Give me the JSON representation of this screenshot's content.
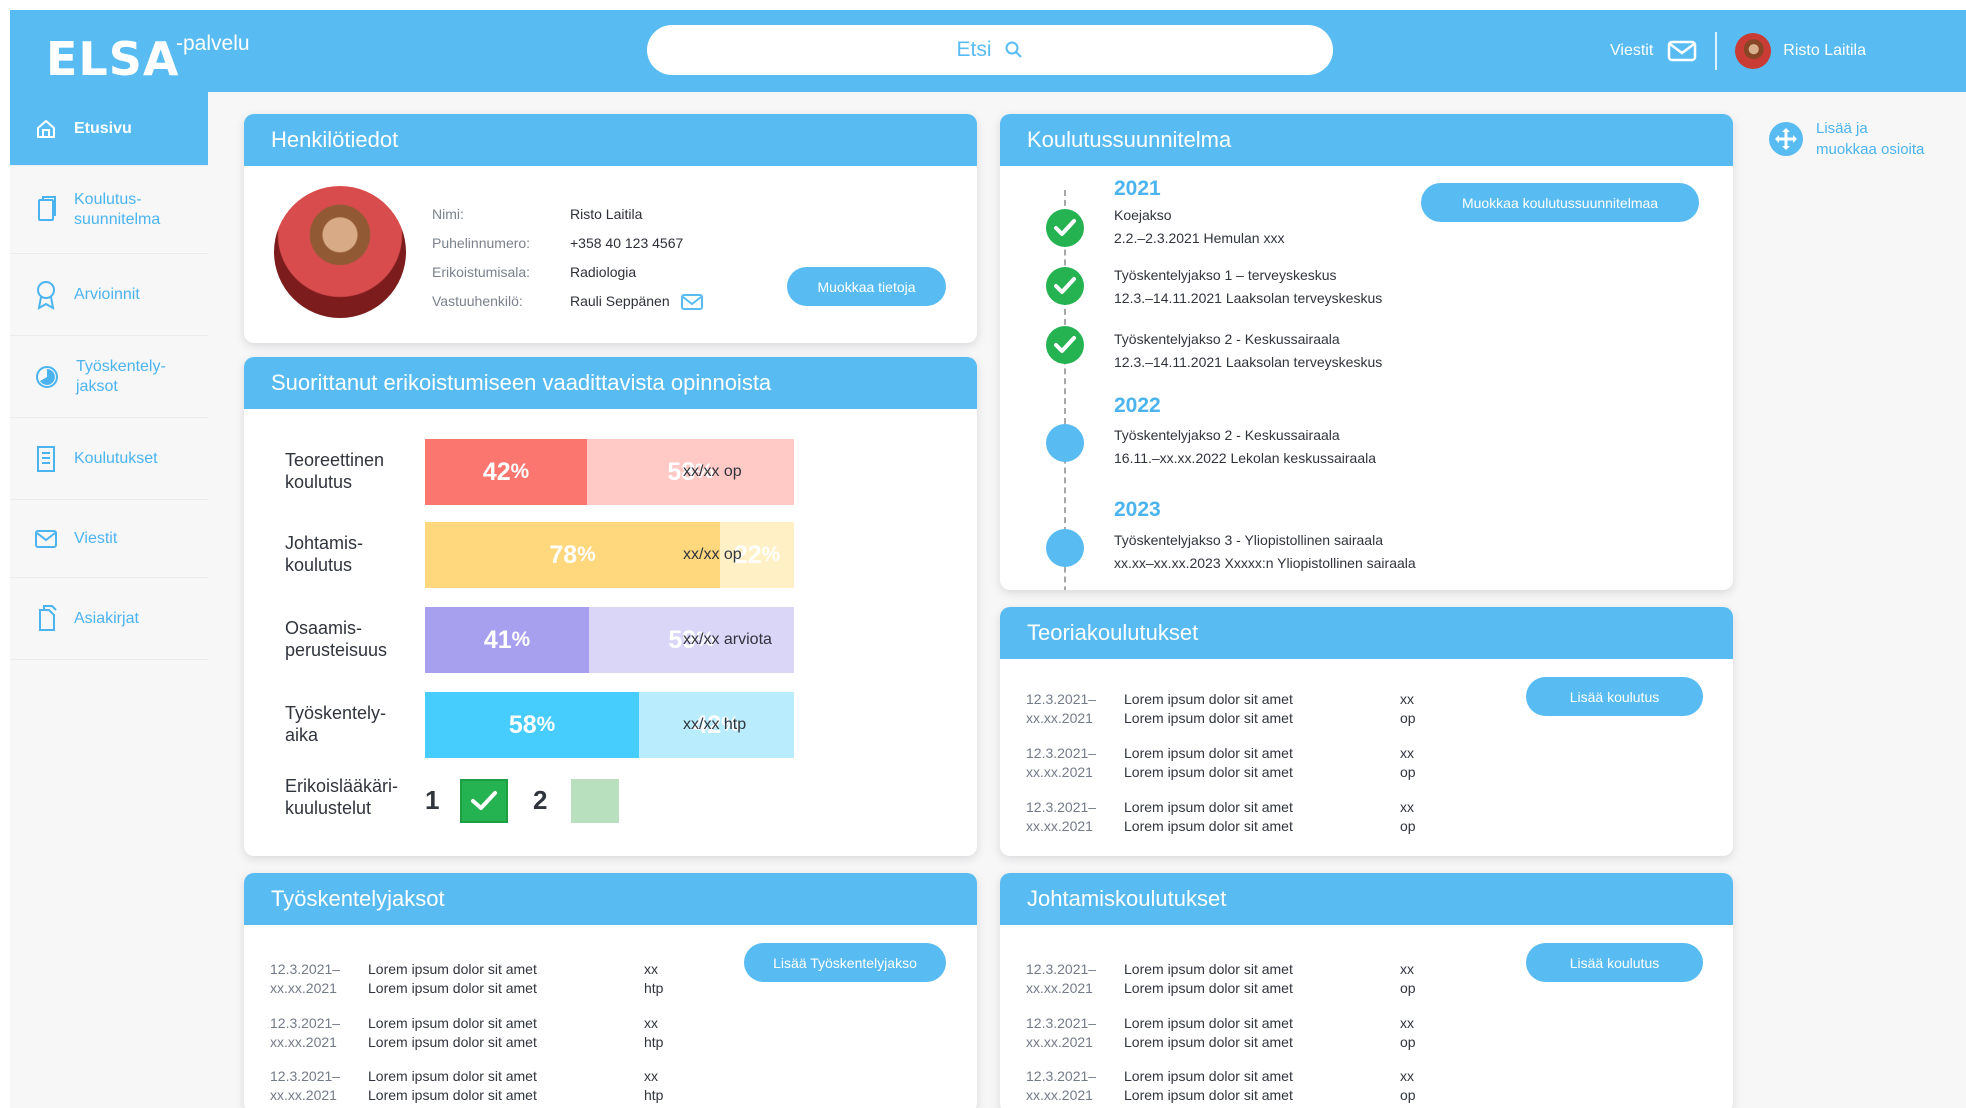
{
  "app": {
    "brand": "ELSA",
    "brand_suffix": "-palvelu",
    "search_placeholder": "Etsi",
    "messages_label": "Viestit",
    "user_name": "Risto Laitila"
  },
  "sidebar": {
    "items": [
      {
        "label": "Etusivu",
        "icon": "home-icon"
      },
      {
        "label": "Koulutus-\nsuunnitelma",
        "icon": "document-copy-icon"
      },
      {
        "label": "Arvioinnit",
        "icon": "award-icon"
      },
      {
        "label": "Työskentely-\njaksot",
        "icon": "clock-icon"
      },
      {
        "label": "Koulutukset",
        "icon": "notebook-icon"
      },
      {
        "label": "Viestit",
        "icon": "mail-icon"
      },
      {
        "label": "Asiakirjat",
        "icon": "documents-icon"
      }
    ]
  },
  "tools": {
    "edit_sections": "Lisää ja\nmuokkaa osioita"
  },
  "personal": {
    "title": "Henkilötiedot",
    "labels": [
      "Nimi:",
      "Puhelinnumero:",
      "Erikoistumisala:",
      "Vastuuhenkilö:"
    ],
    "values": [
      "Risto Laitila",
      "+358 40 123 4567",
      "Radiologia",
      "Rauli Seppänen"
    ],
    "edit_button": "Muokkaa tietoja"
  },
  "studies": {
    "title": "Suorittanut erikoistumiseen vaadittavista opinnoista",
    "rows": [
      {
        "label": "Teoreettinen\nkoulutus",
        "completed": 42,
        "remaining": 58,
        "unit": "xx/xx op"
      },
      {
        "label": "Johtamis-\nkoulutus",
        "completed": 78,
        "remaining": 22,
        "unit": "xx/xx op"
      },
      {
        "label": "Osaamis-\nperusteisuus",
        "completed": 41,
        "remaining": 59,
        "unit": "xx/xx arviota"
      },
      {
        "label": "Työskentely-\naika",
        "completed": 58,
        "remaining": 42,
        "unit": "xx/xx htp"
      }
    ],
    "exam_label": "Erikoislääkäri-\nkuulustelut",
    "exam_items": [
      {
        "number": "1",
        "status": "checked"
      },
      {
        "number": "2",
        "status": "pending"
      }
    ],
    "colors": {
      "theory_done": "#fb766e",
      "theory_left": "#ffc9c6",
      "leadership_done": "#ffd77d",
      "leadership_left": "#fff0c6",
      "competence_done": "#a7a0ef",
      "competence_left": "#dad6f8",
      "work_done": "#46ccfd",
      "work_left": "#b9ecfd"
    }
  },
  "plan": {
    "title": "Koulutussuunnitelma",
    "edit_button": "Muokkaa koulutussuunnitelmaa",
    "years": [
      {
        "year": "2021",
        "items": [
          {
            "title": "Koejakso",
            "detail": "2.2.–2.3.2021 Hemulan xxx",
            "status": "done"
          },
          {
            "title": "Työskentelyjakso 1 – terveyskeskus",
            "detail": "12.3.–14.11.2021 Laaksolan terveyskeskus",
            "status": "done"
          },
          {
            "title": "Työskentelyjakso 2 - Keskussairaala",
            "detail": "12.3.–14.11.2021 Laaksolan terveyskeskus",
            "status": "done"
          }
        ]
      },
      {
        "year": "2022",
        "items": [
          {
            "title": "Työskentelyjakso 2 - Keskussairaala",
            "detail": "16.11.–xx.xx.2022 Lekolan keskussairaala",
            "status": "upcoming"
          }
        ]
      },
      {
        "year": "2023",
        "items": [
          {
            "title": "Työskentelyjakso 3 - Yliopistollinen sairaala",
            "detail": "xx.xx–xx.xx.2023 Xxxxx:n Yliopistollinen sairaala",
            "status": "upcoming"
          }
        ]
      }
    ]
  },
  "theory": {
    "title": "Teoriakoulutukset",
    "button": "Lisää koulutus",
    "rows": [
      {
        "date": "12.3.2021–\nxx.xx.2021",
        "text": "Lorem ipsum dolor sit amet\nLorem ipsum dolor sit amet",
        "amount": "xx op"
      },
      {
        "date": "12.3.2021–\nxx.xx.2021",
        "text": "Lorem ipsum dolor sit amet\nLorem ipsum dolor sit amet",
        "amount": "xx op"
      },
      {
        "date": "12.3.2021–\nxx.xx.2021",
        "text": "Lorem ipsum dolor sit amet\nLorem ipsum dolor sit amet",
        "amount": "xx op"
      }
    ]
  },
  "work_periods": {
    "title": "Työskentelyjaksot",
    "button": "Lisää Työskentelyjakso",
    "rows": [
      {
        "date": "12.3.2021–\nxx.xx.2021",
        "text": "Lorem ipsum dolor sit amet\nLorem ipsum dolor sit amet",
        "amount": "xx htp"
      },
      {
        "date": "12.3.2021–\nxx.xx.2021",
        "text": "Lorem ipsum dolor sit amet\nLorem ipsum dolor sit amet",
        "amount": "xx htp"
      },
      {
        "date": "12.3.2021–\nxx.xx.2021",
        "text": "Lorem ipsum dolor sit amet\nLorem ipsum dolor sit amet",
        "amount": "xx htp"
      }
    ]
  },
  "leadership": {
    "title": "Johtamiskoulutukset",
    "button": "Lisää koulutus",
    "rows": [
      {
        "date": "12.3.2021–\nxx.xx.2021",
        "text": "Lorem ipsum dolor sit amet\nLorem ipsum dolor sit amet",
        "amount": "xx op"
      },
      {
        "date": "12.3.2021–\nxx.xx.2021",
        "text": "Lorem ipsum dolor sit amet\nLorem ipsum dolor sit amet",
        "amount": "xx op"
      },
      {
        "date": "12.3.2021–\nxx.xx.2021",
        "text": "Lorem ipsum dolor sit amet\nLorem ipsum dolor sit amet",
        "amount": "xx op"
      }
    ]
  },
  "colors": {
    "accent": "#58bcf2",
    "background": "#f7f7f8",
    "done": "#25b251",
    "pending": "#b8e0bf"
  }
}
